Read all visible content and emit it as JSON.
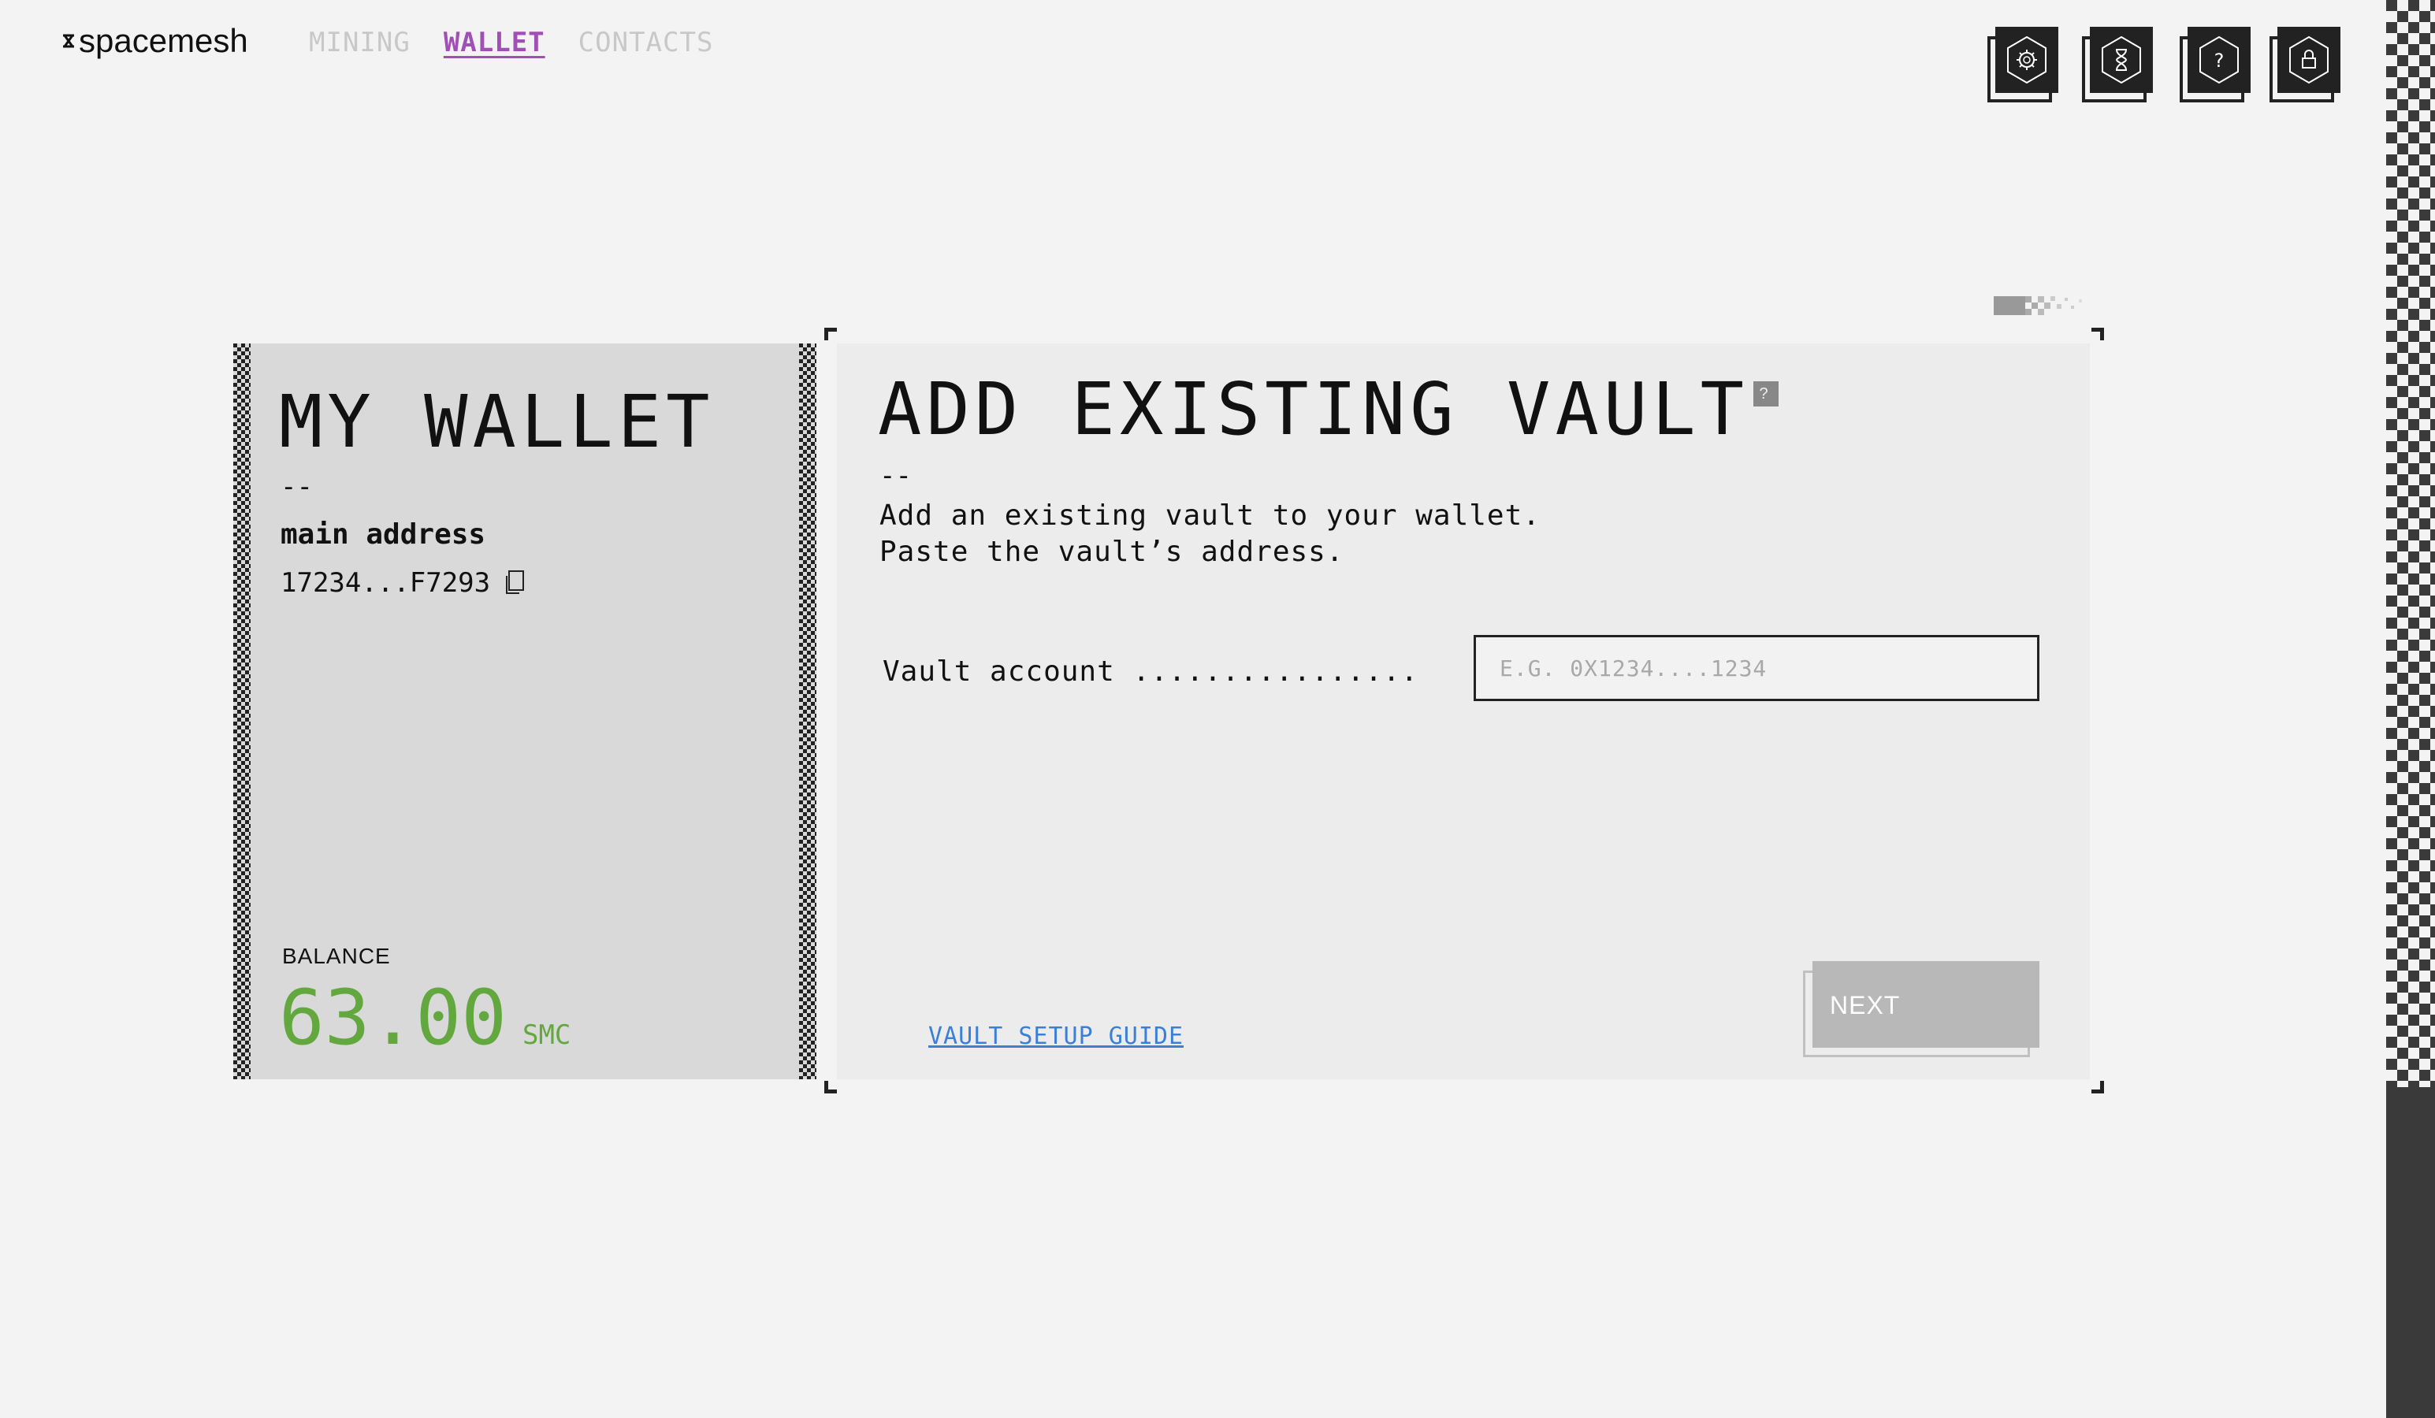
{
  "app": {
    "brand": "spacemesh"
  },
  "nav": [
    {
      "label": "MINING",
      "active": false
    },
    {
      "label": "WALLET",
      "active": true
    },
    {
      "label": "CONTACTS",
      "active": false
    }
  ],
  "top_icons": [
    "settings-icon",
    "hourglass-icon",
    "help-icon",
    "lock-icon"
  ],
  "wallet": {
    "title": "MY WALLET",
    "dash": "--",
    "address_label": "main address",
    "address_value": "17234...F7293",
    "balance_label": "BALANCE",
    "balance_value": "63.00",
    "balance_unit": "SMC"
  },
  "vault": {
    "title": "ADD EXISTING VAULT",
    "help_badge": "?",
    "dash": "--",
    "desc_line1": "Add an existing vault to your wallet.",
    "desc_line2": "Paste the vault’s address.",
    "field_label": "Vault account ................",
    "field_value": "",
    "field_placeholder": "E.G. 0X1234....1234",
    "guide_link": "VAULT SETUP GUIDE",
    "next_label": "NEXT"
  },
  "colors": {
    "accent_purple": "#a050b4",
    "balance_green": "#62a83f",
    "link_blue": "#3b7fd6",
    "dark": "#222222"
  }
}
